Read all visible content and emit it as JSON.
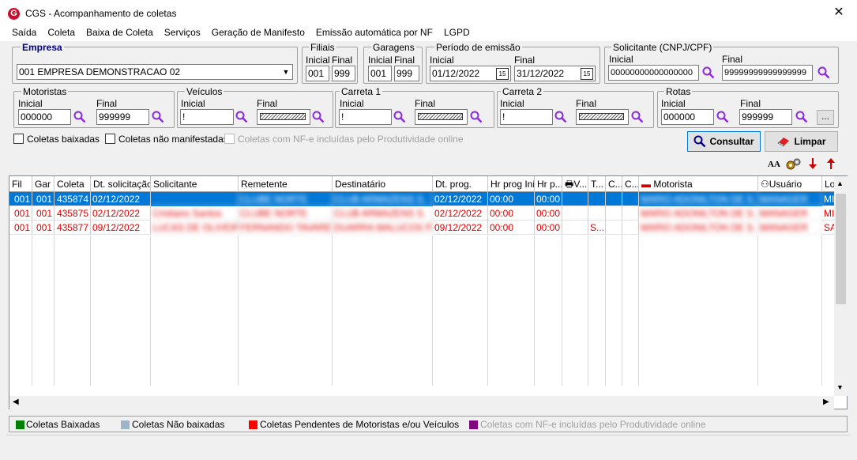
{
  "window": {
    "title": "CGS - Acompanhamento de coletas",
    "close": "✕"
  },
  "menu": [
    "Saída",
    "Coleta",
    "Baixa de Coleta",
    "Serviços",
    "Geração de Manifesto",
    "Emissão automática por NF",
    "LGPD"
  ],
  "filters": {
    "empresa": {
      "legend": "Empresa",
      "value": "001 EMPRESA DEMONSTRACAO 02"
    },
    "filiais": {
      "legend": "Filiais",
      "inicial_label": "Inicial",
      "final_label": "Final",
      "inicial": "001",
      "final": "999"
    },
    "garagens": {
      "legend": "Garagens",
      "inicial_label": "Inicial",
      "final_label": "Final",
      "inicial": "001",
      "final": "999"
    },
    "periodo": {
      "legend": "Período de emissão",
      "inicial_label": "Inicial",
      "final_label": "Final",
      "inicial": "01/12/2022",
      "final": "31/12/2022"
    },
    "solicitante": {
      "legend": "Solicitante (CNPJ/CPF)",
      "inicial_label": "Inicial",
      "final_label": "Final",
      "inicial": "00000000000000000",
      "final": "99999999999999999"
    },
    "motoristas": {
      "legend": "Motoristas",
      "inicial_label": "Inicial",
      "final_label": "Final",
      "inicial": "000000",
      "final": "999999"
    },
    "veiculos": {
      "legend": "Veículos",
      "inicial_label": "Inicial",
      "final_label": "Final",
      "inicial": "!"
    },
    "carreta1": {
      "legend": "Carreta 1",
      "inicial_label": "Inicial",
      "final_label": "Final",
      "inicial": "!"
    },
    "carreta2": {
      "legend": "Carreta 2",
      "inicial_label": "Inicial",
      "final_label": "Final",
      "inicial": "!"
    },
    "rotas": {
      "legend": "Rotas",
      "inicial_label": "Inicial",
      "final_label": "Final",
      "inicial": "000000",
      "final": "999999",
      "more": "..."
    }
  },
  "checkboxes": {
    "baixadas": "Coletas baixadas",
    "nao_manifestadas": "Coletas não manifestadas",
    "nfe": "Coletas com NF-e incluídas pelo Produtividade online"
  },
  "buttons": {
    "consultar": "Consultar",
    "limpar": "Limpar",
    "font_size": "AA"
  },
  "grid": {
    "columns": [
      "Fil",
      "Gar",
      "Coleta",
      "Dt. solicitação",
      "Solicitante",
      "Remetente",
      "Destinatário",
      "Dt. prog.",
      "Hr prog Ini",
      "Hr p...",
      "V...",
      "T...",
      "C...",
      "C...",
      "Motorista",
      "Usuário",
      "Lo"
    ],
    "rows": [
      {
        "fil": "001",
        "gar": "001",
        "coleta": "435874",
        "dt_sol": "02/12/2022",
        "solicitante": "",
        "remetente": "CLUBE NORTE",
        "destinatario": "CLUB ARMAZENS S.",
        "dt_prog": "02/12/2022",
        "hr_ini": "00:00",
        "hr_p": "00:00",
        "t": "",
        "motorista": "MARIO ADONILTON DE S.",
        "usuario": "MANAGER",
        "lo": "MI",
        "selected": true
      },
      {
        "fil": "001",
        "gar": "001",
        "coleta": "435875",
        "dt_sol": "02/12/2022",
        "solicitante": "Cristiano Santos",
        "remetente": "CLUBE NORTE",
        "destinatario": "CLUB ARMAZENS S.",
        "dt_prog": "02/12/2022",
        "hr_ini": "00:00",
        "hr_p": "00:00",
        "t": "",
        "motorista": "MARIO ADONILTON DE S.",
        "usuario": "MANAGER",
        "lo": "MI",
        "selected": false
      },
      {
        "fil": "001",
        "gar": "001",
        "coleta": "435877",
        "dt_sol": "09/12/2022",
        "solicitante": "LUCAS DE OLIVEIR",
        "remetente": "FERNANDO TAVARES",
        "destinatario": "DUARRA MALUCOS P.",
        "dt_prog": "09/12/2022",
        "hr_ini": "00:00",
        "hr_p": "00:00",
        "t": "S...",
        "motorista": "MARIO ADONILTON DE S.",
        "usuario": "MANAGER",
        "lo": "SA",
        "selected": false
      }
    ]
  },
  "legend": [
    {
      "color": "#008000",
      "label": "Coletas Baixadas"
    },
    {
      "color": "#a0b4c8",
      "label": "Coletas Não baixadas"
    },
    {
      "color": "#ff0000",
      "label": "Coletas Pendentes de Motoristas e/ou Veículos"
    },
    {
      "color": "#800080",
      "label": "Coletas com NF-e incluídas pelo Produtividade online"
    }
  ],
  "colors": {
    "row_text": "#e00000",
    "selected_bg": "#0078d7",
    "accent": "#0078d7"
  }
}
